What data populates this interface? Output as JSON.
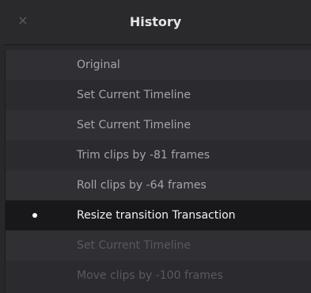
{
  "header": {
    "title": "History",
    "close_icon": "close-icon",
    "close_glyph": "×"
  },
  "history": {
    "current_index": 5,
    "items": [
      {
        "label": "Original",
        "state": "past"
      },
      {
        "label": "Set Current Timeline",
        "state": "past"
      },
      {
        "label": "Set Current Timeline",
        "state": "past"
      },
      {
        "label": "Trim clips by -81 frames",
        "state": "past"
      },
      {
        "label": "Roll clips by -64 frames",
        "state": "past"
      },
      {
        "label": "Resize transition Transaction",
        "state": "current"
      },
      {
        "label": "Set Current Timeline",
        "state": "future"
      },
      {
        "label": "Move clips by -100 frames",
        "state": "future"
      }
    ]
  },
  "colors": {
    "background": "#28282b",
    "current_row": "#18181a",
    "text_past": "#a5a5aa",
    "text_current": "#f2f2f4",
    "text_future": "#5a5a5e"
  }
}
